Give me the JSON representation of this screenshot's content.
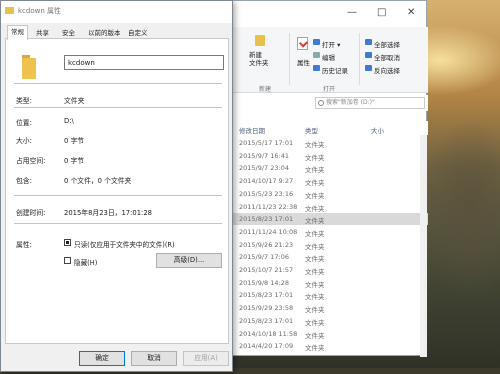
{
  "dialog": {
    "title": "kcdown 属性",
    "tabs": [
      "常规",
      "共享",
      "安全",
      "以前的版本",
      "自定义"
    ],
    "name_value": "kcdown",
    "properties": [
      {
        "label": "类型:",
        "value": "文件夹"
      },
      {
        "label": "位置:",
        "value": "D:\\"
      },
      {
        "label": "大小:",
        "value": "0 字节"
      },
      {
        "label": "占用空间:",
        "value": "0 字节"
      },
      {
        "label": "包含:",
        "value": "0 个文件，0 个文件夹"
      },
      {
        "label": "创建时间:",
        "value": "2015年8月23日，17:01:28"
      }
    ],
    "attributes_label": "属性:",
    "readonly_label": "只读(仅应用于文件夹中的文件)(R)",
    "hidden_label": "隐藏(H)",
    "advanced_button": "高级(D)...",
    "buttons": {
      "ok": "确定",
      "cancel": "取消",
      "apply": "应用(A)"
    }
  },
  "explorer": {
    "window_controls": [
      "—",
      "□",
      "✕"
    ],
    "ribbon": {
      "new_folder": "新建\n文件夹",
      "new_group": "新建",
      "properties": "属性",
      "open": "打开 ▾",
      "edit": "编辑",
      "history": "历史记录",
      "open_group": "打开",
      "select_all": "全部选择",
      "select_none": "全部取消",
      "invert": "反向选择"
    },
    "search_placeholder": "搜索\"新加卷 (D:)\"",
    "columns": {
      "date": "修改日期",
      "type": "类型",
      "size": "大小"
    },
    "rows": [
      {
        "date": "2015/5/17 17:01",
        "type": "文件夹"
      },
      {
        "date": "2015/9/7 16:41",
        "type": "文件夹"
      },
      {
        "date": "2015/9/7 23:04",
        "type": "文件夹"
      },
      {
        "date": "2014/10/17 9:27",
        "type": "文件夹"
      },
      {
        "date": "2015/5/23 23:16",
        "type": "文件夹"
      },
      {
        "date": "2011/11/23 22:38",
        "type": "文件夹"
      },
      {
        "date": "2015/8/23 17:01",
        "type": "文件夹"
      },
      {
        "date": "2011/11/24 10:08",
        "type": "文件夹"
      },
      {
        "date": "2015/9/26 21:23",
        "type": "文件夹"
      },
      {
        "date": "2015/9/7 17:06",
        "type": "文件夹"
      },
      {
        "date": "2015/10/7 21:57",
        "type": "文件夹"
      },
      {
        "date": "2015/9/8 14:28",
        "type": "文件夹"
      },
      {
        "date": "2015/8/23 17:01",
        "type": "文件夹"
      },
      {
        "date": "2015/9/29 23:58",
        "type": "文件夹"
      },
      {
        "date": "2015/8/23 17:01",
        "type": "文件夹"
      },
      {
        "date": "2014/10/18 11:58",
        "type": "文件夹"
      },
      {
        "date": "2014/4/20 17:09",
        "type": "文件夹"
      }
    ],
    "selected_row": 6
  }
}
